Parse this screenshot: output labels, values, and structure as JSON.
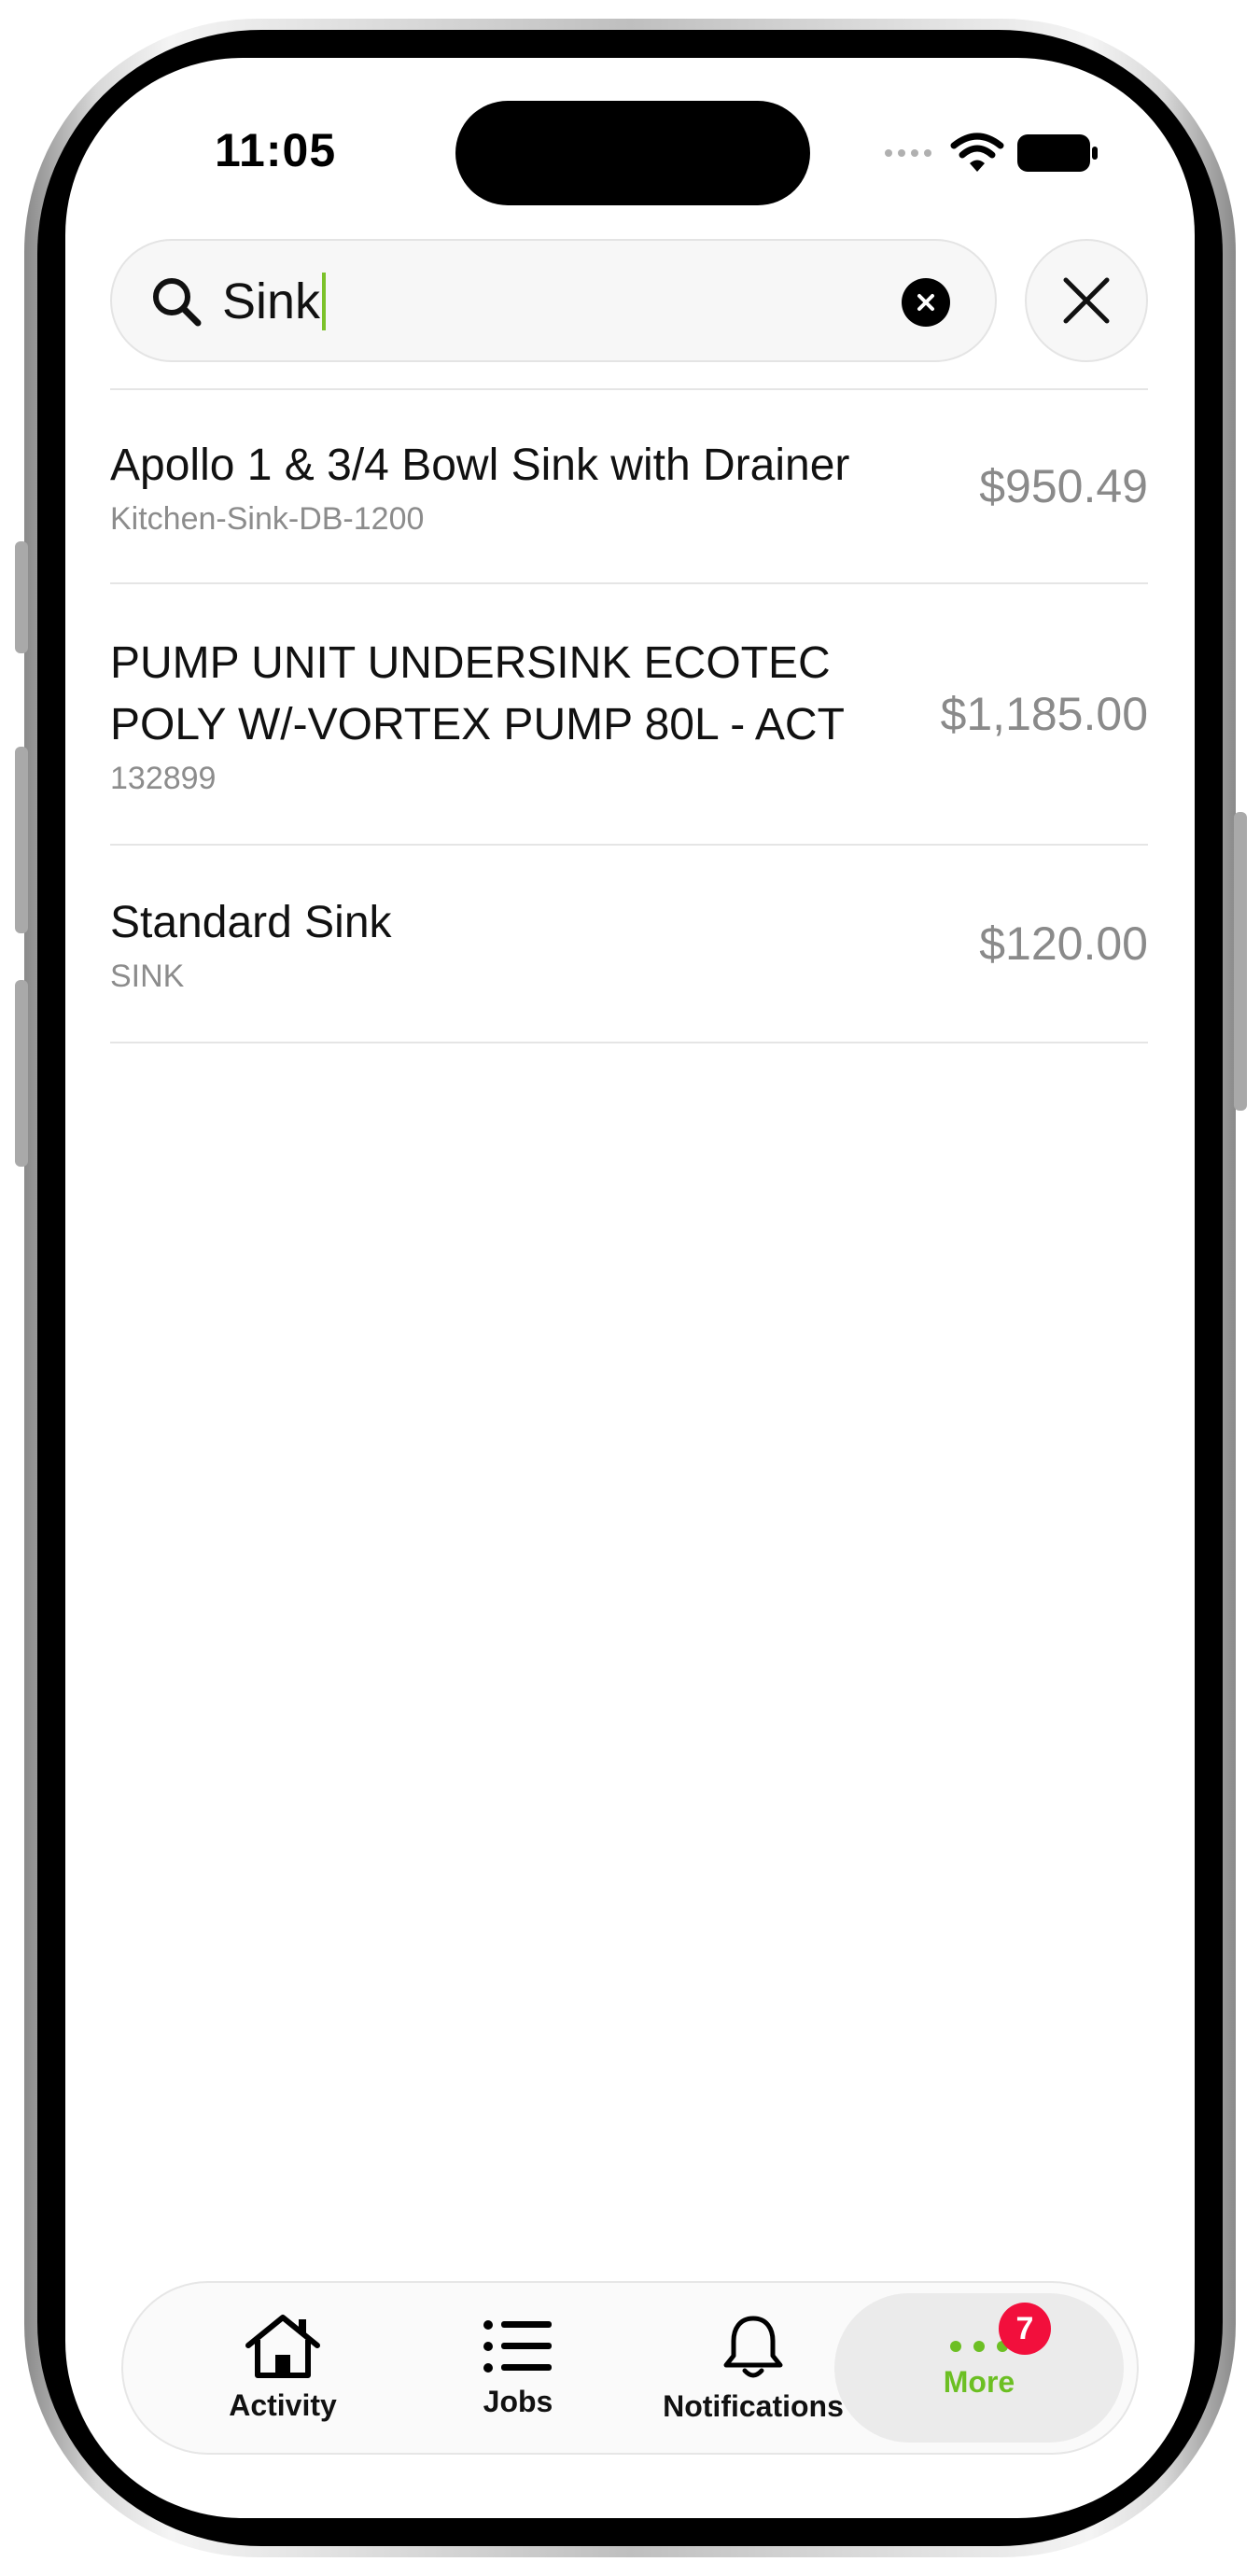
{
  "status_bar": {
    "time": "11:05"
  },
  "search": {
    "value": "Sink"
  },
  "results": [
    {
      "name_lines": [
        "Apollo 1 & 3/4 Bowl Sink with Drainer"
      ],
      "code": "Kitchen-Sink-DB-1200",
      "price": "$950.49"
    },
    {
      "name_lines": [
        "PUMP UNIT UNDERSINK ECOTEC",
        "POLY W/-VORTEX PUMP 80L - ACT"
      ],
      "code": "132899",
      "price": "$1,185.00"
    },
    {
      "name_lines": [
        "Standard Sink"
      ],
      "code": "SINK",
      "price": "$120.00"
    }
  ],
  "tab_bar": {
    "tabs": [
      {
        "label": "Activity",
        "icon": "house-icon"
      },
      {
        "label": "Jobs",
        "icon": "list-icon"
      },
      {
        "label": "Notifications",
        "icon": "bell-icon"
      },
      {
        "label": "More",
        "icon": "more-dots-icon",
        "badge": "7",
        "active": true
      }
    ]
  },
  "colors": {
    "accent": "#6cbf23",
    "badge": "#f20f3c",
    "price": "#8a8a8a"
  }
}
